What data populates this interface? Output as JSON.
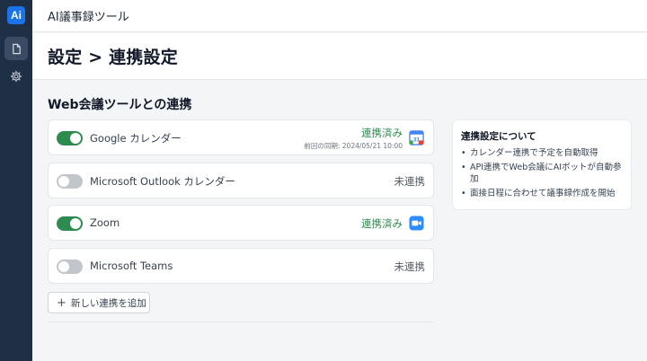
{
  "app": {
    "logo_text": "Ai",
    "title": "AI議事録ツール"
  },
  "page": {
    "title": "設定 > 連携設定"
  },
  "section": {
    "title": "Web会議ツールとの連携"
  },
  "integrations": [
    {
      "name": "Google カレンダー",
      "enabled": true,
      "status": "連携済み",
      "last_sync": "前回の同期: 2024/05/21 10:00",
      "icon": "google-calendar-icon",
      "icon_text": "31"
    },
    {
      "name": "Microsoft Outlook カレンダー",
      "enabled": false,
      "status": "未連携"
    },
    {
      "name": "Zoom",
      "enabled": true,
      "status": "連携済み",
      "icon": "zoom-icon"
    },
    {
      "name": "Microsoft Teams",
      "enabled": false,
      "status": "未連携"
    }
  ],
  "add_button": {
    "label": "新しい連携を追加"
  },
  "info": {
    "title": "連携設定について",
    "items": [
      "カレンダー連携で予定を自動取得",
      "API連携でWeb会議にAIボットが自動参加",
      "面接日程に合わせて議事録作成を開始"
    ]
  },
  "colors": {
    "accent": "#2e8b4f",
    "sidebar": "#1f2f46",
    "logo": "#1a73e8"
  }
}
